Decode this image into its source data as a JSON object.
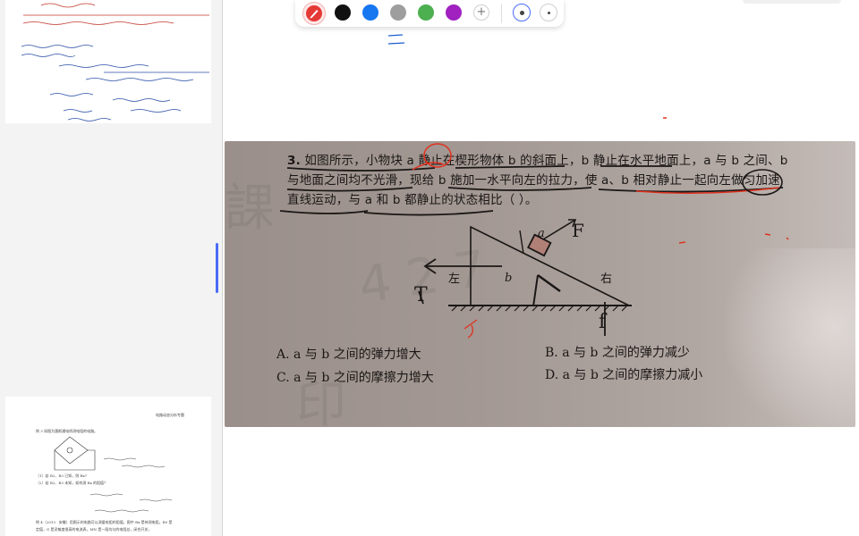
{
  "toolbar": {
    "colors": [
      {
        "name": "red",
        "hex": "#e53935",
        "active": true
      },
      {
        "name": "black",
        "hex": "#111111"
      },
      {
        "name": "blue",
        "hex": "#1677f0"
      },
      {
        "name": "gray",
        "hex": "#9e9e9e"
      },
      {
        "name": "green",
        "hex": "#4caf50"
      },
      {
        "name": "purple",
        "hex": "#a020c0"
      }
    ],
    "add_label": "+",
    "tool_icon": "pencil-icon",
    "stroke_sizes": [
      "large",
      "small"
    ]
  },
  "question": {
    "number": "3.",
    "line1": "如图所示，小物块 a 静止在楔形物体 b 的斜面上，b 静止在水平地面上，a 与 b 之间、b",
    "line2": "与地面之间均不光滑，现给 b 施加一水平向左的拉力，使 a、b 相对静止一起向左做匀加速",
    "line3": "直线运动，与 a 和 b 都静止的状态相比（     ）。",
    "options": {
      "A": "A. a 与 b 之间的弹力增大",
      "B": "B. a 与 b 之间的弹力减少",
      "C": "C. a 与 b 之间的摩擦力增大",
      "D": "D. a 与 b 之间的摩擦力减小"
    }
  },
  "figure": {
    "left_word": "左",
    "right_word": "右",
    "block_label": "a",
    "wedge_label": "b",
    "force_F": "F",
    "force_T": "T",
    "force_f": "f"
  },
  "sidebar": {
    "page2_title": "电路动态分析专题",
    "page2_example": "例 3  如图为惠斯通电桥测电阻的电路。",
    "page2_q1": "（1）若 R2、R3 已知，则 Rx?",
    "page2_q2": "（2）若 R2、R3 未知，如何测 Rx 的阻值？",
    "page2_example2": "例 4（2013 · 安徽）用图示的电路可以测量电阻的阻值，图中 Rx 是待测电阻，R0 是",
    "page2_example2b": "定值，G 是灵敏度很高的电流表，MN 是一段均匀的电阻丝，闭合开关，"
  },
  "accent_colors": {
    "annotation_red": "#e0301e",
    "annotation_blue": "#1a5fd0",
    "scroll_indicator": "#4a6cf7"
  }
}
